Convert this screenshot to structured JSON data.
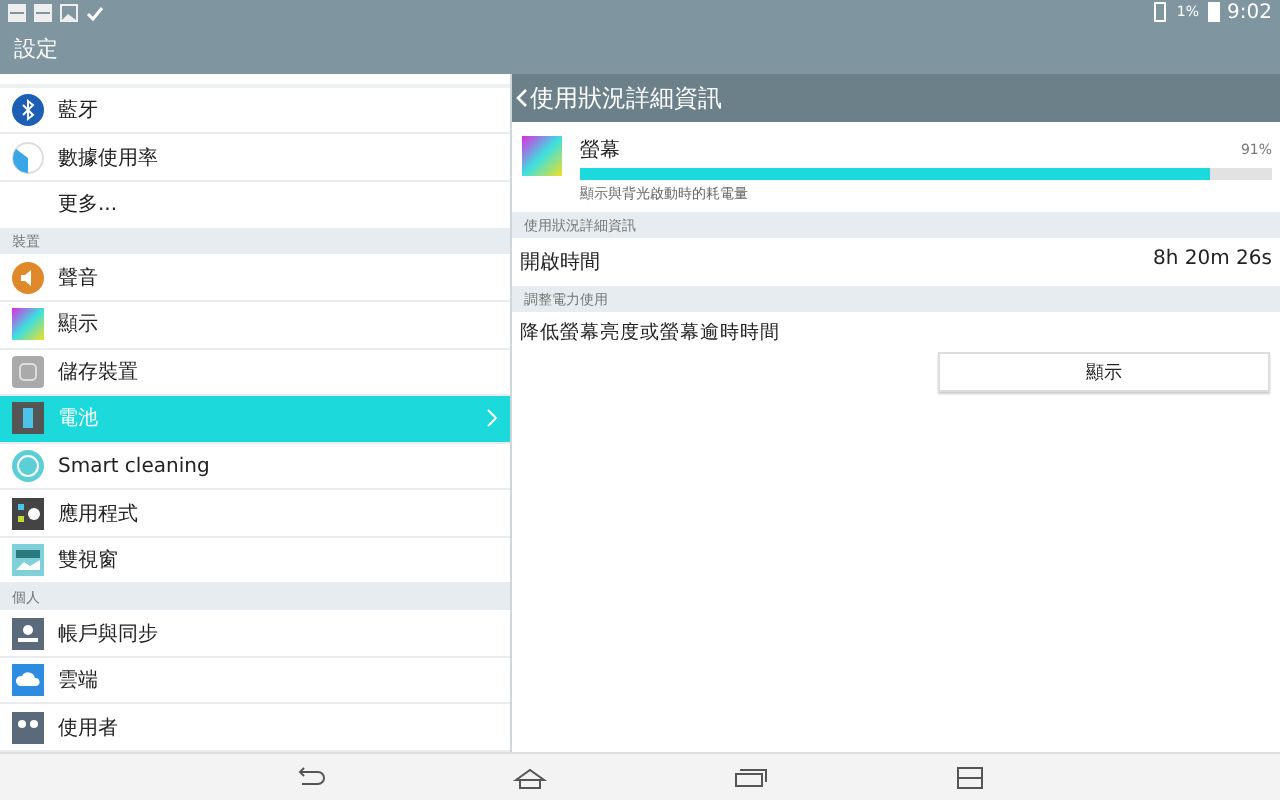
{
  "status_bar": {
    "battery_text": "1%",
    "time": "9:02"
  },
  "title_bar": {
    "title": "設定"
  },
  "sidebar": {
    "groups": [
      {
        "items": [
          {
            "label": "藍牙",
            "selected": false
          },
          {
            "label": "數據使用率",
            "selected": false
          },
          {
            "label": "更多...",
            "selected": false
          }
        ]
      },
      {
        "header": "裝置",
        "items": [
          {
            "label": "聲音",
            "selected": false
          },
          {
            "label": "顯示",
            "selected": false
          },
          {
            "label": "儲存裝置",
            "selected": false
          },
          {
            "label": "電池",
            "selected": true
          },
          {
            "label": "Smart cleaning",
            "selected": false
          },
          {
            "label": "應用程式",
            "selected": false
          },
          {
            "label": "雙視窗",
            "selected": false
          }
        ]
      },
      {
        "header": "個人",
        "items": [
          {
            "label": "帳戶與同步",
            "selected": false
          },
          {
            "label": "雲端",
            "selected": false
          },
          {
            "label": "使用者",
            "selected": false
          }
        ]
      }
    ]
  },
  "detail": {
    "title": "使用狀況詳細資訊",
    "usage": {
      "name": "螢幕",
      "percent": "91%",
      "level": 0.91,
      "description": "顯示與背光啟動時的耗電量"
    },
    "sections": [
      {
        "header": "使用狀況詳細資訊",
        "kind": "stat",
        "label": "開啟時間",
        "value": "8h 20m 26s"
      },
      {
        "header": "調整電力使用",
        "kind": "action",
        "label": "降低螢幕亮度或螢幕逾時時間",
        "button": "顯示"
      }
    ]
  }
}
